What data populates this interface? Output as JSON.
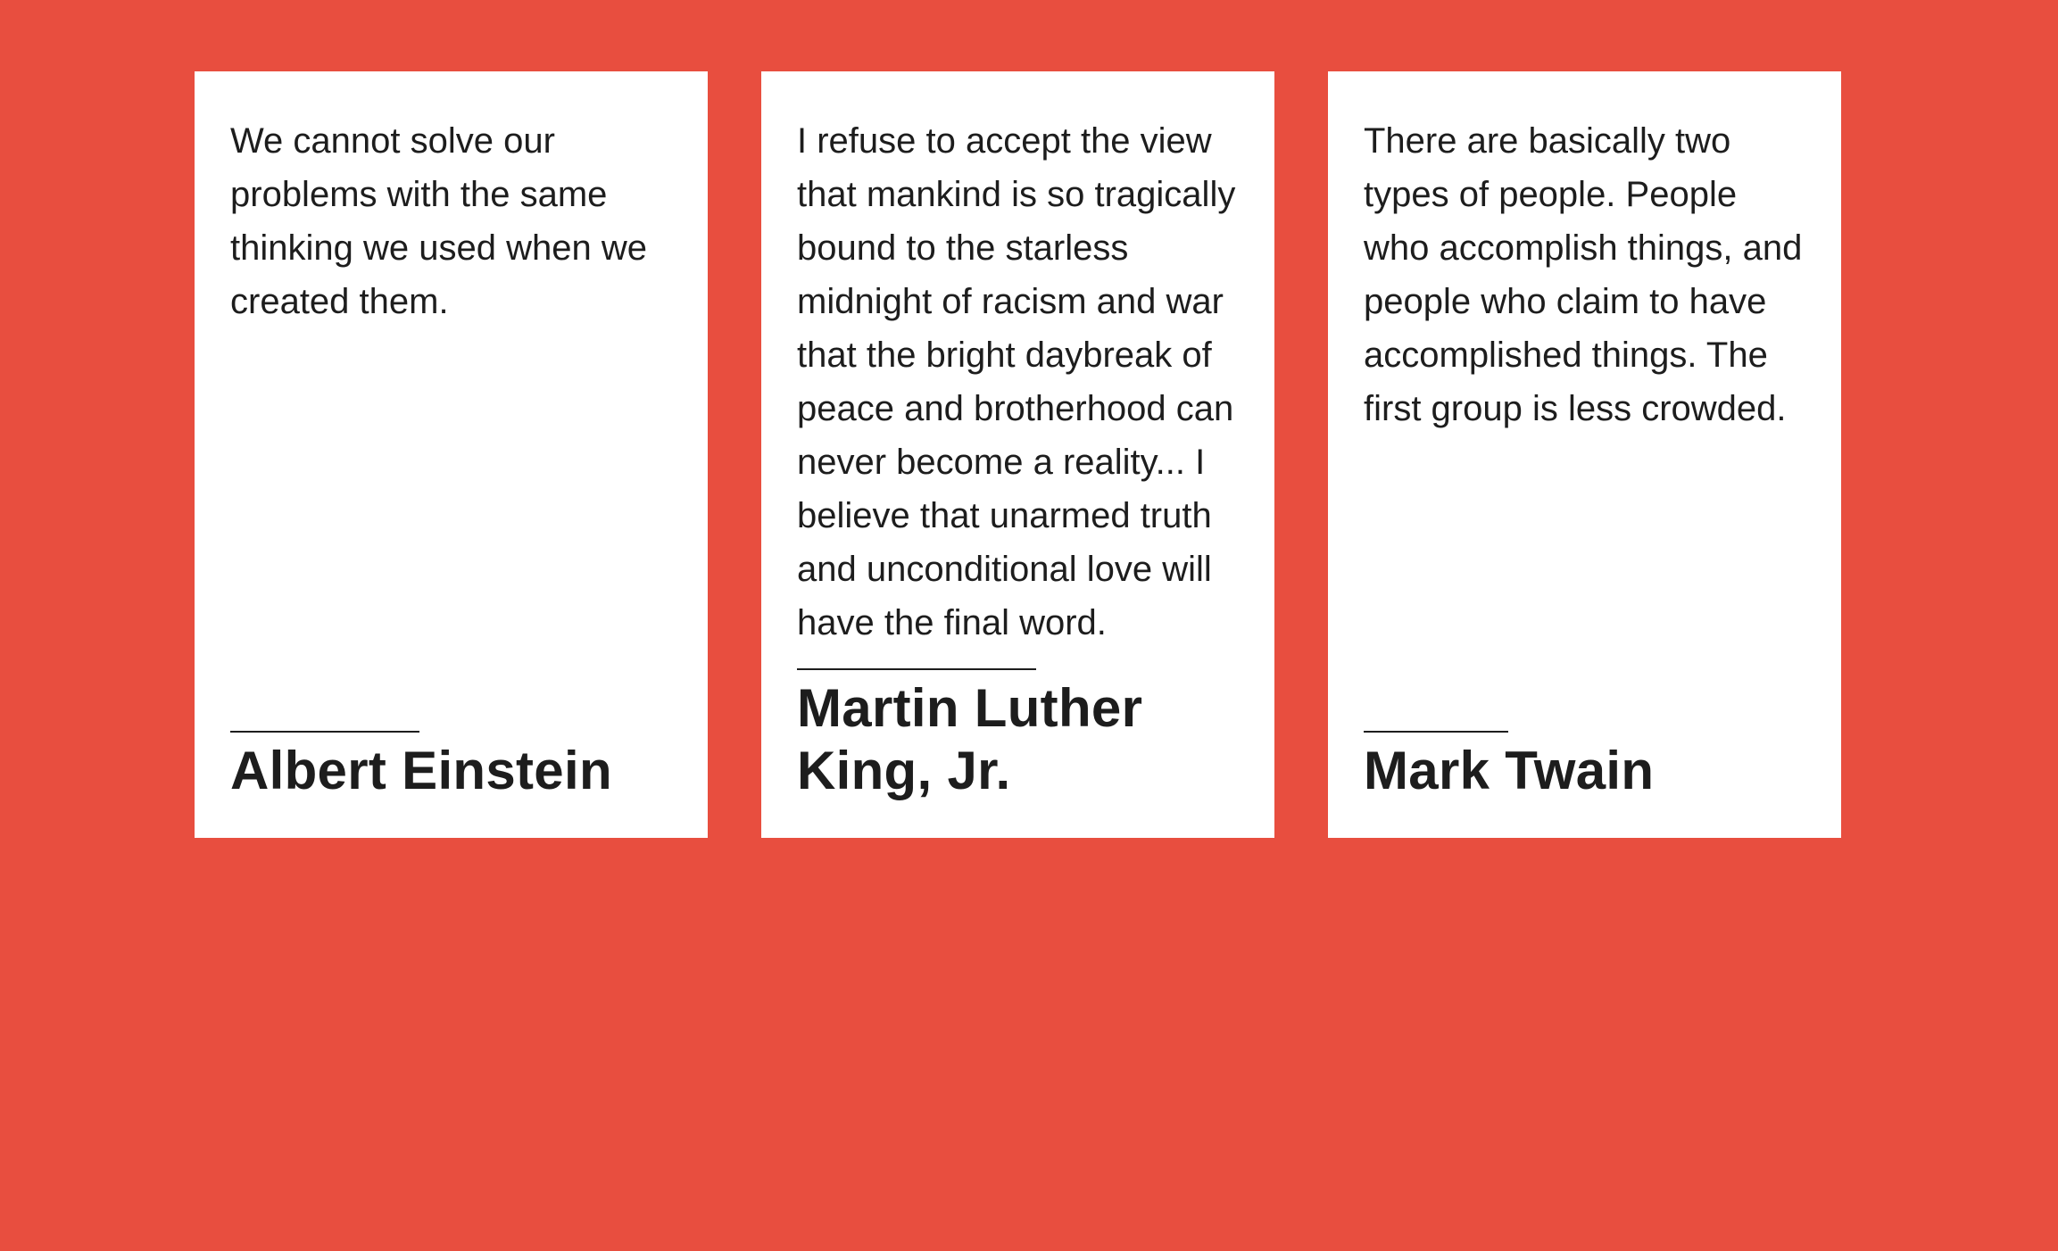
{
  "page": {
    "background_color": "#e84e3f",
    "card_color": "#ffffff",
    "text_color": "#1d1d1d"
  },
  "cards": [
    {
      "quote": "We cannot solve our problems with the same thinking we used when we created them.",
      "author": "Albert Einstein"
    },
    {
      "quote": "I refuse to accept the view that mankind is so tragically bound to the starless midnight of racism and war that the bright daybreak of peace and brotherhood can never become a reality... I believe that unarmed truth and unconditional love will have the final word.",
      "author": "Martin Luther King, Jr."
    },
    {
      "quote": "There are basically two types of people. People who accomplish things, and people who claim to have accomplished things. The first group is less crowded.",
      "author": "Mark Twain"
    }
  ]
}
